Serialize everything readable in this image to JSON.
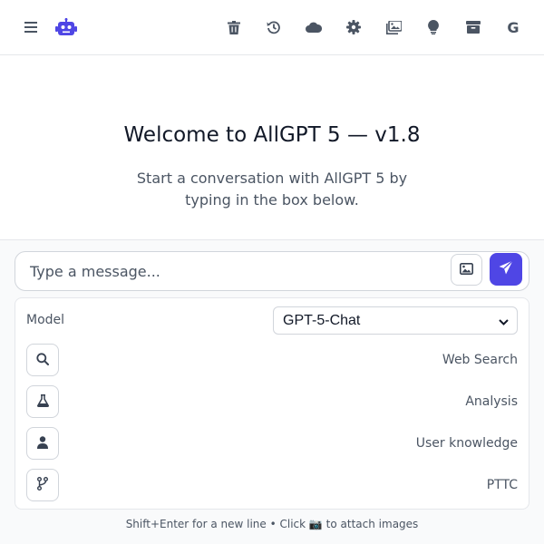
{
  "header": {
    "icons": [
      "menu-icon",
      "robot-logo-icon",
      "trash-icon",
      "history-icon",
      "cloud-icon",
      "gear-icon",
      "images-icon",
      "lightbulb-icon",
      "archive-icon",
      "google-icon"
    ],
    "google_letter": "G"
  },
  "welcome": {
    "title": "Welcome to AllGPT 5 — v1.8",
    "subtitle": "Start a conversation with AllGPT 5 by typing in the box below."
  },
  "composer": {
    "placeholder": "Type a message...",
    "value": ""
  },
  "options": {
    "model_label": "Model",
    "model_value": "GPT-5-Chat",
    "tools": [
      {
        "label": "Web Search",
        "icon": "search-icon"
      },
      {
        "label": "Analysis",
        "icon": "flask-icon"
      },
      {
        "label": "User knowledge",
        "icon": "user-icon"
      },
      {
        "label": "PTTC",
        "icon": "branch-icon"
      }
    ]
  },
  "footer": {
    "hint": "Shift+Enter for a new line • Click 📷 to attach images"
  },
  "colors": {
    "accent": "#4f46e5",
    "text_muted": "#4b5563",
    "border": "#e5e7eb"
  }
}
